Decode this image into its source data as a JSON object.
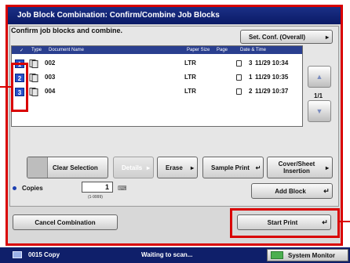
{
  "title": "Job Block Combination: Confirm/Combine Job Blocks",
  "instruction": "Confirm job blocks and combine.",
  "set_conf_button": "Set. Conf. (Overall)",
  "list": {
    "headers": [
      "Type",
      "Document Name",
      "Paper Size",
      "Page",
      "Date & Time"
    ],
    "rows": [
      {
        "number": "1",
        "name": "002",
        "paper": "LTR",
        "pages": "3",
        "datetime": "11/29 10:34"
      },
      {
        "number": "2",
        "name": "003",
        "paper": "LTR",
        "pages": "1",
        "datetime": "11/29 10:35"
      },
      {
        "number": "3",
        "name": "004",
        "paper": "LTR",
        "pages": "2",
        "datetime": "11/29 10:37"
      }
    ]
  },
  "page_indicator": "1/1",
  "buttons": {
    "clear_selection": "Clear Selection",
    "details": "Details",
    "erase": "Erase",
    "sample_print": "Sample Print",
    "cover_sheet": "Cover/Sheet Insertion",
    "add_block": "Add Block",
    "cancel_combination": "Cancel Combination",
    "start_print": "Start Print"
  },
  "copies": {
    "label": "Copies",
    "value": "1",
    "range": "(1-9999)"
  },
  "status_bar": {
    "job_id": "0015 Copy",
    "status": "Waiting to scan...",
    "monitor": "System Monitor"
  },
  "colors": {
    "title_bar": "#0a1a66",
    "accent_red": "#d90000",
    "block_number": "#2850c8"
  }
}
